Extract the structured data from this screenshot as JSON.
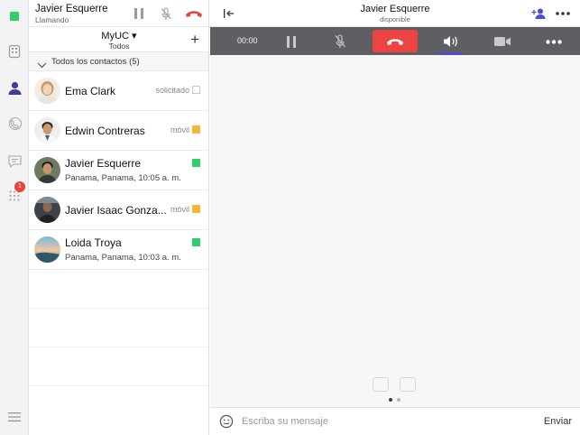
{
  "colors": {
    "accent": "#4a4dd6",
    "status_green": "#2fcf6a",
    "status_orange": "#f5b63a",
    "hangup_red": "#ee4343",
    "control_bar": "#5d5f63"
  },
  "rail": {
    "icons": [
      "status-available",
      "building-icon",
      "contacts-icon",
      "call-history-icon",
      "chat-icon",
      "dialpad-icon",
      "menu-icon"
    ],
    "dialpad_badge": "1"
  },
  "callbar": {
    "name": "Javier Esquerre",
    "state": "Llamando"
  },
  "selector": {
    "label": "MyUC",
    "sublabel": "Todos",
    "add": "+"
  },
  "group": {
    "label": "Todos los contactos (5)"
  },
  "contacts": [
    {
      "name": "Ema Clark",
      "tag": "solicitado",
      "location": "",
      "status": "requested"
    },
    {
      "name": "Edwin Contreras",
      "tag": "móvil",
      "location": "",
      "status": "mobile"
    },
    {
      "name": "Javier Esquerre",
      "tag": "",
      "location": "Panama, Panama, 10:05 a. m.",
      "status": "available"
    },
    {
      "name": "Javier Isaac Gonza...",
      "tag": "móvil",
      "location": "",
      "status": "mobile"
    },
    {
      "name": "Loida Troya",
      "tag": "",
      "location": "Panama, Panama, 10:03 a. m.",
      "status": "available"
    }
  ],
  "conversation": {
    "title": "Javier Esquerre",
    "subtitle": "disponible",
    "timer": "00:00",
    "pager": {
      "pages": 2,
      "active": 1
    }
  },
  "compose": {
    "placeholder": "Escriba su mensaje",
    "send_label": "Enviar"
  }
}
